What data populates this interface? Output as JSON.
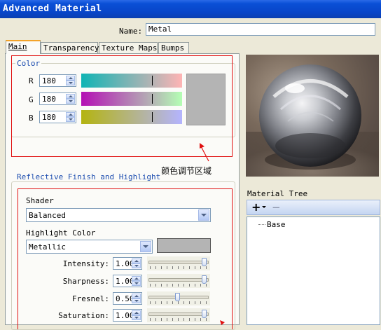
{
  "window": {
    "title": "Advanced Material"
  },
  "name": {
    "label": "Name:",
    "value": "Metal"
  },
  "tabs": [
    {
      "label": "Main",
      "active": true
    },
    {
      "label": "Transparency",
      "active": false
    },
    {
      "label": "Texture Maps",
      "active": false
    },
    {
      "label": "Bumps",
      "active": false
    }
  ],
  "color": {
    "title": "Color",
    "channels": [
      {
        "label": "R",
        "value": "180"
      },
      {
        "label": "G",
        "value": "180"
      },
      {
        "label": "B",
        "value": "180"
      }
    ],
    "swatch": "#b4b4b4",
    "annotation": "颜色调节区域"
  },
  "reflective": {
    "title": "Reflective Finish and Highlight",
    "shader_label": "Shader",
    "shader_value": "Balanced",
    "highlight_label": "Highlight Color",
    "highlight_value": "Metallic",
    "highlight_swatch": "#b4b4b4",
    "params": [
      {
        "label": "Intensity:",
        "value": "1.000",
        "level": 1.0
      },
      {
        "label": "Sharpness:",
        "value": "1.000",
        "level": 1.0
      },
      {
        "label": "Fresnel:",
        "value": "0.500",
        "level": 0.5
      },
      {
        "label": "Saturation:",
        "value": "1.000",
        "level": 1.0
      }
    ]
  },
  "tree": {
    "label": "Material Tree",
    "add_glyph": "+",
    "remove_glyph": "−",
    "items": [
      {
        "label": "Base"
      }
    ]
  },
  "colors": {
    "annotation_red": "#e01010",
    "group_title_blue": "#1f4fb0"
  }
}
